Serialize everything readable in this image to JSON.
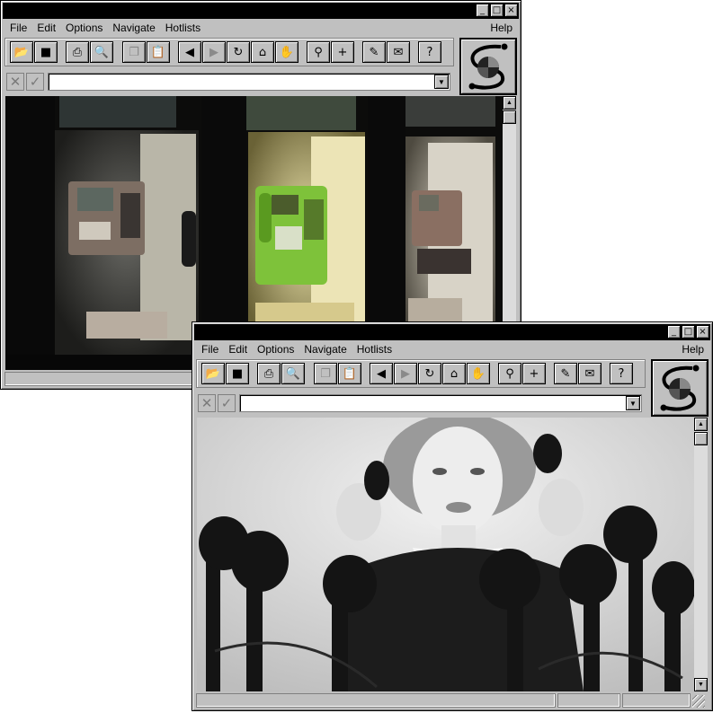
{
  "menu": {
    "file": "File",
    "edit": "Edit",
    "options": "Options",
    "navigate": "Navigate",
    "hotlists": "Hotlists",
    "help": "Help"
  },
  "titlebar_buttons": {
    "minimize": "_",
    "maximize": "□",
    "close": "×"
  },
  "toolbar_icons": [
    "open-folder-icon",
    "save-disk-icon",
    "print-icon",
    "print-preview-icon",
    "copy-icon",
    "paste-icon",
    "back-arrow-icon",
    "forward-arrow-icon",
    "reload-icon",
    "home-icon",
    "stop-hand-icon",
    "find-binoculars-icon",
    "add-hotlist-icon",
    "edit-note-icon",
    "mail-icon",
    "help-question-icon"
  ],
  "url": {
    "value": ""
  },
  "windows": [
    {
      "id": "browser-window-top",
      "content_image": "payphones-photo"
    },
    {
      "id": "browser-window-bottom",
      "content_image": "woman-with-telephones-photo"
    }
  ]
}
